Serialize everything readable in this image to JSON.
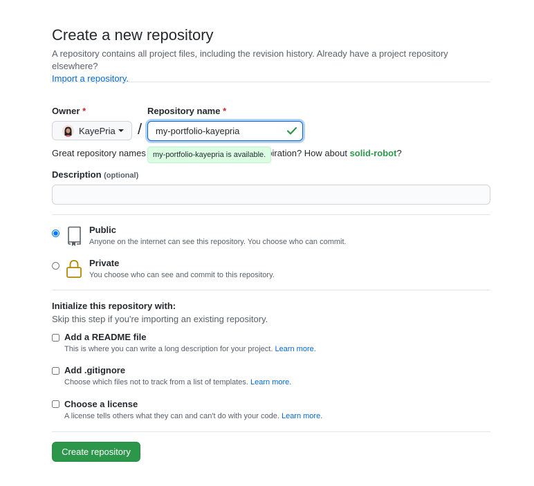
{
  "page": {
    "title": "Create a new repository",
    "subtitle": "A repository contains all project files, including the revision history. Already have a project repository elsewhere?",
    "import_link": "Import a repository."
  },
  "owner": {
    "label": "Owner",
    "required_mark": "*",
    "value": "KayePria"
  },
  "repo_name": {
    "label": "Repository name",
    "required_mark": "*",
    "value": "my-portfolio-kayepria",
    "availability_tooltip": "my-portfolio-kayepria is available.",
    "divider": "/"
  },
  "suggestion": {
    "prefix_visible": "Great repository names a",
    "middle_visible": "inspiration? How about",
    "suggested_name": "solid-robot",
    "suffix": "?"
  },
  "description": {
    "label": "Description",
    "optional": "(optional)",
    "value": ""
  },
  "visibility": {
    "selected": "Public",
    "options": [
      {
        "title": "Public",
        "desc": "Anyone on the internet can see this repository. You choose who can commit.",
        "icon": "repo-icon",
        "checked": true
      },
      {
        "title": "Private",
        "desc": "You choose who can see and commit to this repository.",
        "icon": "lock-icon",
        "checked": false
      }
    ]
  },
  "init": {
    "title": "Initialize this repository with:",
    "subtitle": "Skip this step if you're importing an existing repository.",
    "options": [
      {
        "title": "Add a README file",
        "desc": "This is where you can write a long description for your project.",
        "link": "Learn more.",
        "checked": false
      },
      {
        "title": "Add .gitignore",
        "desc": "Choose which files not to track from a list of templates.",
        "link": "Learn more.",
        "checked": false
      },
      {
        "title": "Choose a license",
        "desc": "A license tells others what they can and can't do with your code.",
        "link": "Learn more.",
        "checked": false
      }
    ]
  },
  "submit": {
    "label": "Create repository"
  },
  "colors": {
    "accent_blue": "#0366d6",
    "success_green": "#2c974b",
    "tooltip_bg": "#dcffe4",
    "lock_gold": "#b08800",
    "required_red": "#cb2431"
  }
}
